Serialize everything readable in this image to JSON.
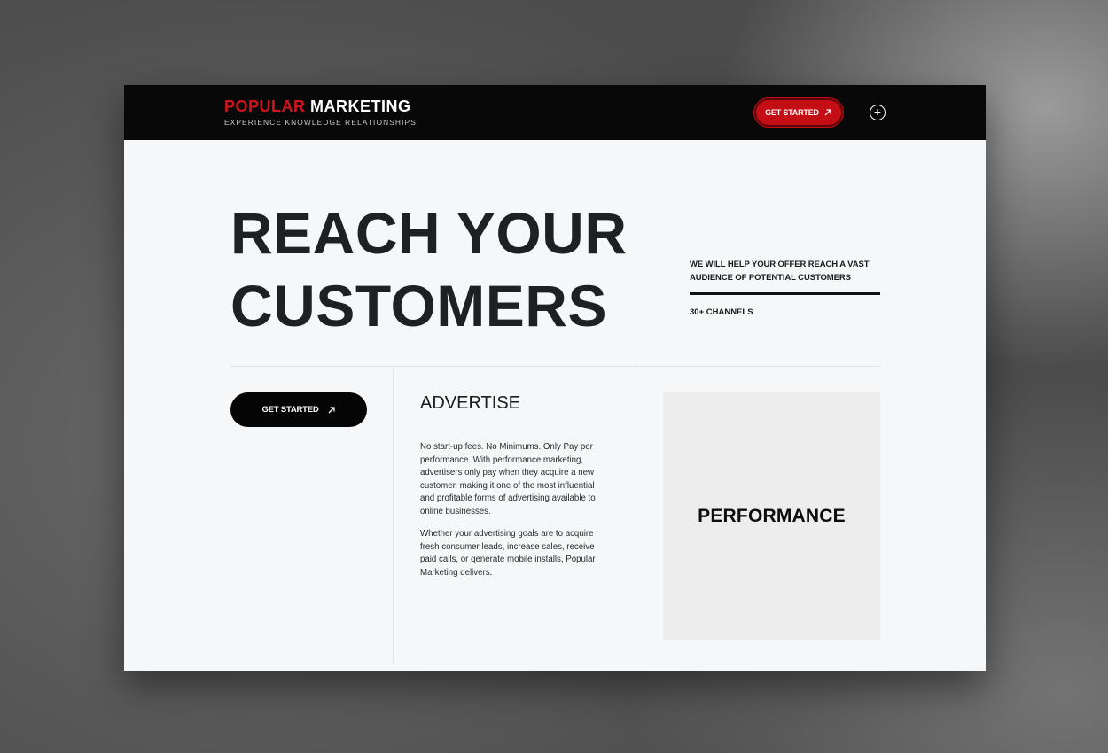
{
  "header": {
    "brand_red": "POPULAR",
    "brand_white": " MARKETING",
    "tagline": "EXPERIENCE KNOWLEDGE RELATIONSHIPS",
    "cta_label": "GET STARTED",
    "menu_icon": "plus-circle-icon"
  },
  "hero": {
    "title_line1": "REACH YOUR",
    "title_line2": "CUSTOMERS",
    "side_text": "WE WILL HELP YOUR OFFER REACH A VAST AUDIENCE OF POTENTIAL CUSTOMERS",
    "channels": "30+ CHANNELS"
  },
  "main": {
    "cta_label": "GET STARTED",
    "advertise_title": "ADVERTISE",
    "advertise_p1": "No start-up fees. No Minimums. Only Pay per performance. With performance marketing, advertisers only pay when they acquire a new customer, making it one of the most influential and profitable forms of advertising available to online businesses.",
    "advertise_p2": "Whether your advertising goals are to acquire fresh consumer leads, increase sales, receive paid calls, or generate mobile installs, Popular Marketing delivers.",
    "performance_label": "PERFORMANCE"
  },
  "colors": {
    "accent_red": "#d0141b",
    "topbar": "#080808",
    "page_bg": "#f6f7f9"
  }
}
